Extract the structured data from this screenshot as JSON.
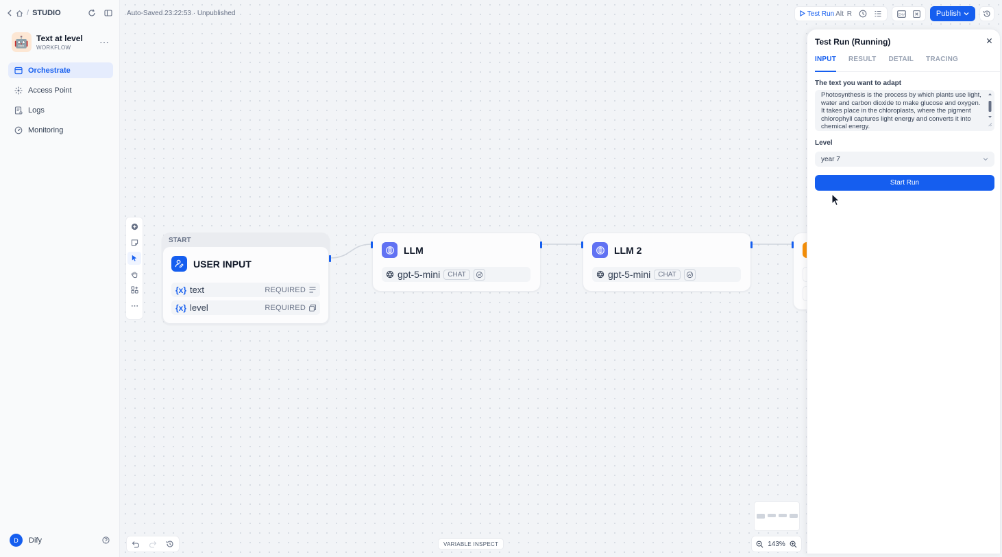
{
  "breadcrumb": {
    "separator": "/",
    "section": "STUDIO"
  },
  "app": {
    "name": "Text at level",
    "type": "WORKFLOW",
    "avatar": "🤖"
  },
  "nav": [
    {
      "label": "Orchestrate",
      "icon": "layout-icon",
      "active": true
    },
    {
      "label": "Access Point",
      "icon": "access-point-icon",
      "active": false
    },
    {
      "label": "Logs",
      "icon": "logs-icon",
      "active": false
    },
    {
      "label": "Monitoring",
      "icon": "monitoring-icon",
      "active": false
    }
  ],
  "user": {
    "initial": "D",
    "name": "Dify"
  },
  "status": {
    "autosave": "Auto-Saved 23:22:53 · Unpublished"
  },
  "toolbar": {
    "test_run": "Test Run",
    "shortcut_alt": "Alt",
    "shortcut_key": "R",
    "publish": "Publish"
  },
  "nodes": {
    "start": {
      "badge": "START",
      "title": "USER INPUT",
      "vars": [
        {
          "prefix": "{x}",
          "name": "text",
          "required": "REQUIRED"
        },
        {
          "prefix": "{x}",
          "name": "level",
          "required": "REQUIRED"
        }
      ]
    },
    "llm1": {
      "title": "LLM",
      "model": "gpt-5-mini",
      "mode": "CHAT"
    },
    "llm2": {
      "title": "LLM 2",
      "model": "gpt-5-mini",
      "mode": "CHAT"
    }
  },
  "canvas": {
    "zoom": "143%",
    "variable_inspect": "VARIABLE INSPECT"
  },
  "panel": {
    "title": "Test Run (Running)",
    "tabs": [
      "INPUT",
      "RESULT",
      "DETAIL",
      "TRACING"
    ],
    "active_tab": "INPUT",
    "text_label": "The text you want to adapt",
    "text_value": "Photosynthesis is the process by which plants use light, water and carbon dioxide to make glucose and oxygen. It takes place in the chloroplasts, where the pigment chlorophyll captures light energy and converts it into chemical energy.",
    "level_label": "Level",
    "level_value": "year 7",
    "start_button": "Start Run"
  },
  "colors": {
    "accent": "#155eef",
    "llm_icon": "#6172f3",
    "next_node": "#f79009"
  }
}
